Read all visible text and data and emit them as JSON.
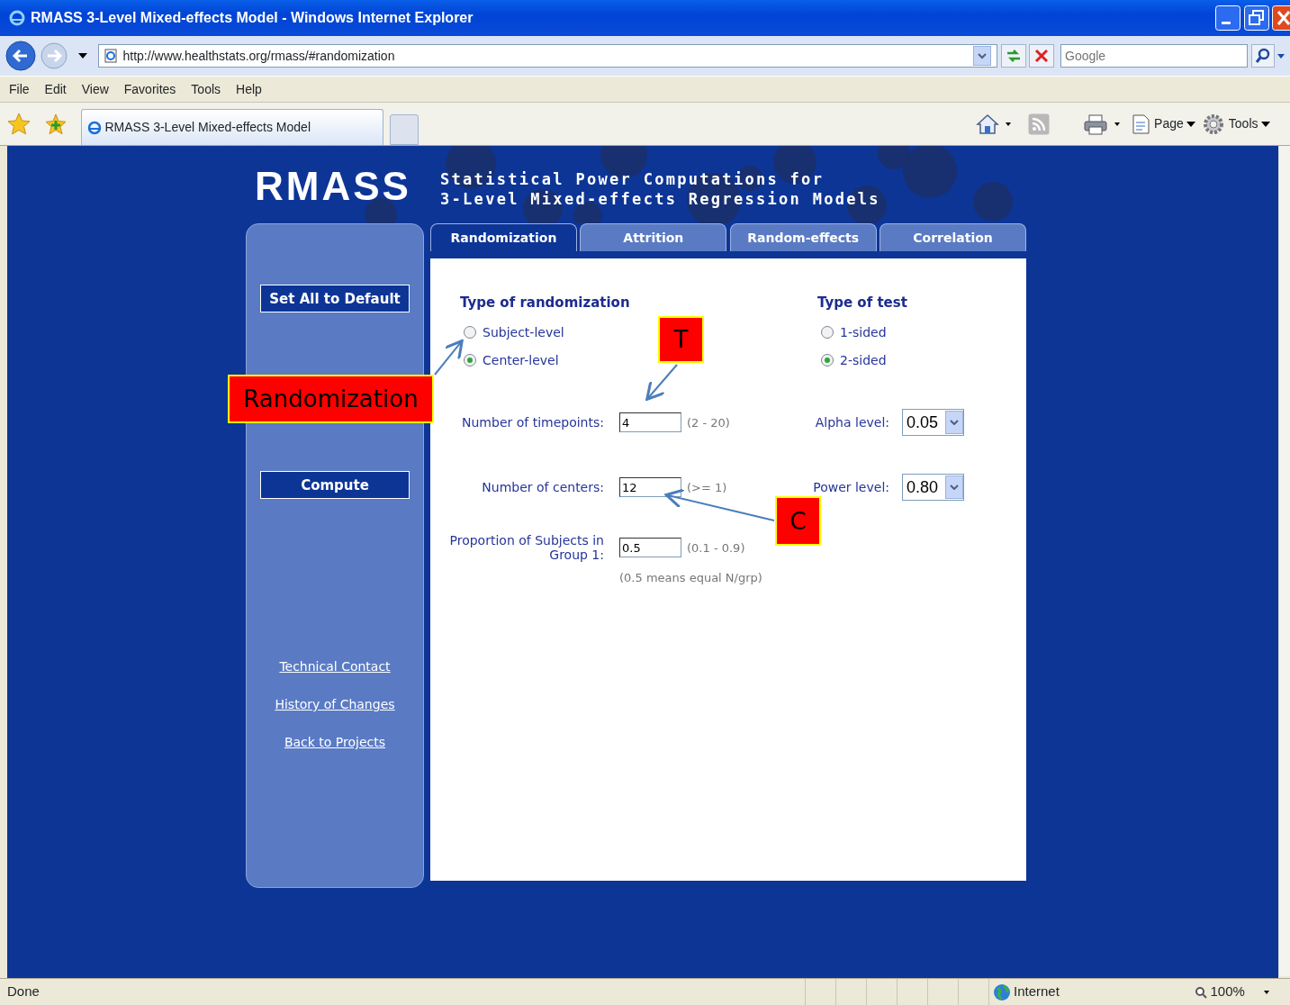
{
  "window": {
    "title": "RMASS 3-Level Mixed-effects Model - Windows Internet Explorer"
  },
  "address_bar": {
    "url": "http://www.healthstats.org/rmass/#randomization",
    "search_placeholder": "Google"
  },
  "menu": [
    "File",
    "Edit",
    "View",
    "Favorites",
    "Tools",
    "Help"
  ],
  "browser_tab": {
    "title": "RMASS 3-Level Mixed-effects Model"
  },
  "command_bar": [
    "Page",
    "Tools"
  ],
  "page": {
    "logo": "RMASS",
    "subtitle": [
      "Statistical Power Computations for",
      "3-Level Mixed-effects Regression Models"
    ],
    "sidebar": {
      "buttons": [
        "Set All to Default",
        "Compute"
      ],
      "links": [
        "Technical Contact",
        "History of Changes",
        "Back to Projects"
      ]
    },
    "tabs": [
      {
        "label": "Randomization",
        "selected": true
      },
      {
        "label": "Attrition",
        "selected": false
      },
      {
        "label": "Random-effects",
        "selected": false
      },
      {
        "label": "Correlation",
        "selected": false
      }
    ],
    "randomization": {
      "title": "Type of randomization",
      "options": [
        {
          "label": "Subject-level",
          "selected": false
        },
        {
          "label": "Center-level",
          "selected": true
        }
      ]
    },
    "test": {
      "title": "Type of test",
      "options": [
        {
          "label": "1-sided",
          "selected": false
        },
        {
          "label": "2-sided",
          "selected": true
        }
      ]
    },
    "inputs": [
      {
        "label": "Number of timepoints:",
        "value": "4",
        "hint": "(2 - 20)"
      },
      {
        "label": "Number of centers:",
        "value": "12",
        "hint": "(>= 1)"
      },
      {
        "label": "Proportion of Subjects in Group 1:",
        "value": "0.5",
        "hint": "(0.1 - 0.9)"
      }
    ],
    "note": "(0.5 means equal N/grp)",
    "selects": [
      {
        "label": "Alpha level:",
        "value": "0.05"
      },
      {
        "label": "Power level:",
        "value": "0.80"
      }
    ]
  },
  "annotations": [
    {
      "label": "Randomization"
    },
    {
      "label": "T"
    },
    {
      "label": "C"
    }
  ],
  "status_bar": {
    "text": "Done",
    "zone": "Internet",
    "zoom": "100%"
  }
}
